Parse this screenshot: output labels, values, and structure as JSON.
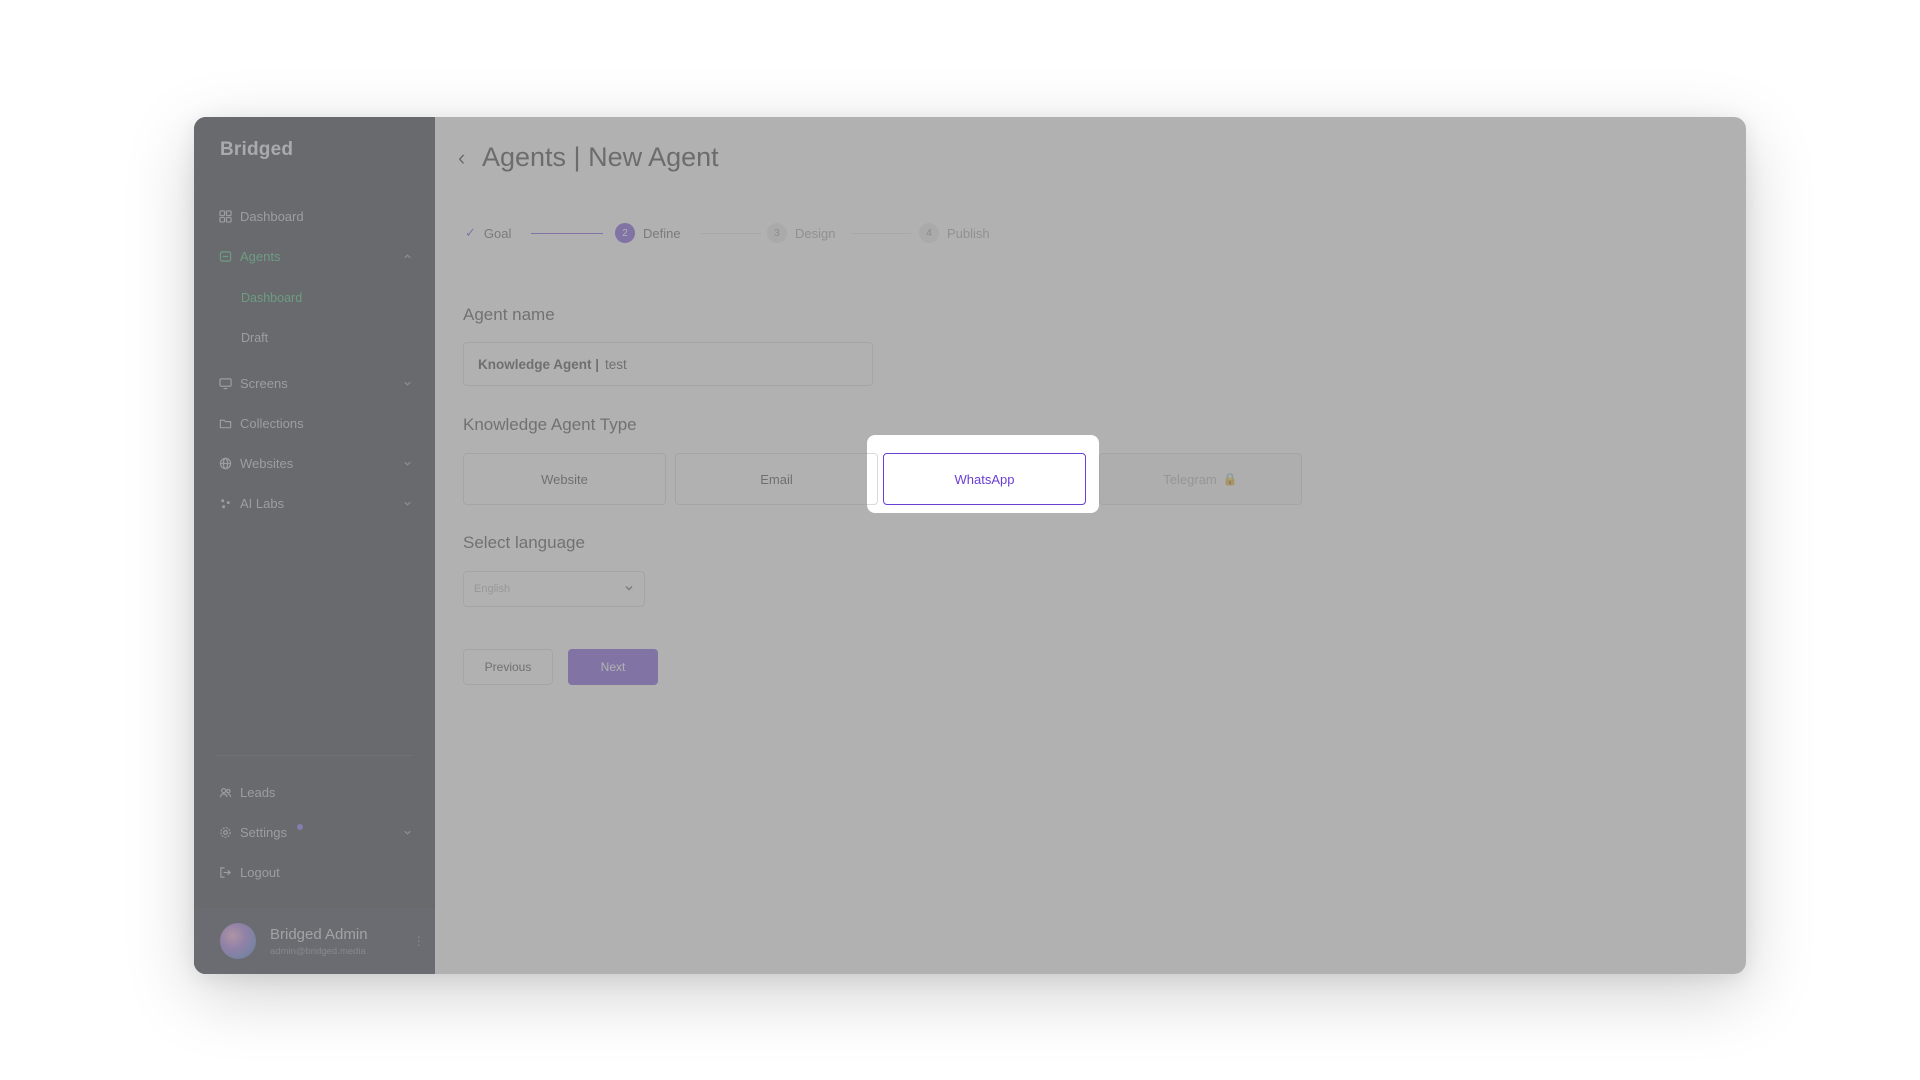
{
  "sidebar": {
    "logo": "Bridged",
    "items": [
      {
        "label": "Dashboard",
        "icon": "grid-icon"
      },
      {
        "label": "Agents",
        "icon": "agents-icon",
        "expanded": true
      },
      {
        "label": "Screens",
        "icon": "monitor-icon"
      },
      {
        "label": "Collections",
        "icon": "folder-icon"
      },
      {
        "label": "Websites",
        "icon": "globe-icon"
      },
      {
        "label": "AI Labs",
        "icon": "sparkle-icon"
      }
    ],
    "agents_sub": [
      "Dashboard",
      "Draft"
    ],
    "bottom_items": [
      {
        "label": "Leads",
        "icon": "users-icon"
      },
      {
        "label": "Settings",
        "icon": "gear-icon"
      },
      {
        "label": "Logout",
        "icon": "logout-icon"
      }
    ],
    "user": {
      "name": "Bridged Admin",
      "email": "admin@bridged.media"
    }
  },
  "header": {
    "title": "Agents | New Agent"
  },
  "stepper": [
    {
      "label": "Goal",
      "state": "done"
    },
    {
      "label": "Define",
      "state": "current",
      "number": "2"
    },
    {
      "label": "Design",
      "state": "future",
      "number": "3"
    },
    {
      "label": "Publish",
      "state": "future",
      "number": "4"
    }
  ],
  "form": {
    "agent_name_label": "Agent name",
    "agent_name_prefix": "Knowledge Agent |",
    "agent_name_value": "test",
    "type_label": "Knowledge Agent Type",
    "types": [
      "Website",
      "Email",
      "WhatsApp",
      "Telegram"
    ],
    "language_label": "Select language",
    "language_value": "English",
    "previous_label": "Previous",
    "next_label": "Next"
  },
  "colors": {
    "accent": "#6a3fd6",
    "active_nav": "#2fbf71",
    "sidebar_bg": "#1e2230"
  }
}
